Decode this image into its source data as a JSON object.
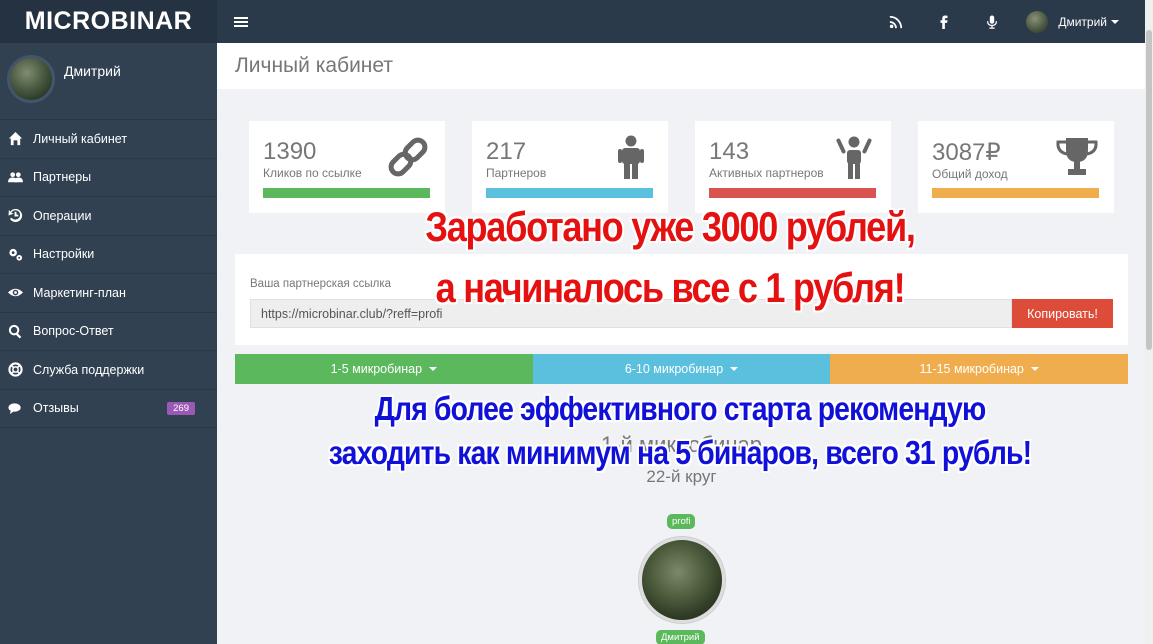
{
  "brand": "MICROBINAR",
  "sidebar": {
    "user_name": "Дмитрий",
    "items": [
      {
        "label": "Личный кабинет",
        "icon": "home-icon"
      },
      {
        "label": "Партнеры",
        "icon": "users-icon"
      },
      {
        "label": "Операции",
        "icon": "history-icon"
      },
      {
        "label": "Настройки",
        "icon": "gears-icon"
      },
      {
        "label": "Маркетинг-план",
        "icon": "eye-icon"
      },
      {
        "label": "Вопрос-Ответ",
        "icon": "search-icon"
      },
      {
        "label": "Служба поддержки",
        "icon": "lifebuoy-icon"
      },
      {
        "label": "Отзывы",
        "icon": "comments-icon",
        "badge": "269"
      }
    ]
  },
  "topbar": {
    "icons": [
      "rss-icon",
      "facebook-icon",
      "microphone-icon"
    ],
    "user_name": "Дмитрий"
  },
  "page": {
    "title": "Личный кабинет"
  },
  "stats": [
    {
      "value": "1390",
      "label": "Кликов по ссылке",
      "color": "#5cb85c",
      "icon": "chain-link-icon"
    },
    {
      "value": "217",
      "label": "Партнеров",
      "color": "#5bc0de",
      "icon": "person-icon"
    },
    {
      "value": "143",
      "label": "Активных партнеров",
      "color": "#d9534f",
      "icon": "person-arms-up-icon"
    },
    {
      "value": "3087₽",
      "label": "Общий доход",
      "color": "#f0ad4e",
      "icon": "trophy-icon"
    }
  ],
  "referral": {
    "label": "Ваша партнерская ссылка",
    "url": "https://microbinar.club/?reff=profi",
    "copy_label": "Копировать!"
  },
  "tabs": [
    {
      "label": "1-5 микробинар",
      "color": "#5cb85c"
    },
    {
      "label": "6-10 микробинар",
      "color": "#5bc0de"
    },
    {
      "label": "11-15 микробинар",
      "color": "#f0ad4e"
    }
  ],
  "tree": {
    "heading": "1-й микробинар",
    "round": "22-й круг",
    "top_tag": "profi",
    "bottom_tag": "Дмитрий"
  },
  "promo": {
    "line1": "Заработано уже 3000 рублей,",
    "line2": "а начиналось все с 1 рубля!",
    "line3": "Для более эффективного старта рекомендую",
    "line4": "заходить как минимум на 5 бинаров, всего 31 рубль!"
  }
}
